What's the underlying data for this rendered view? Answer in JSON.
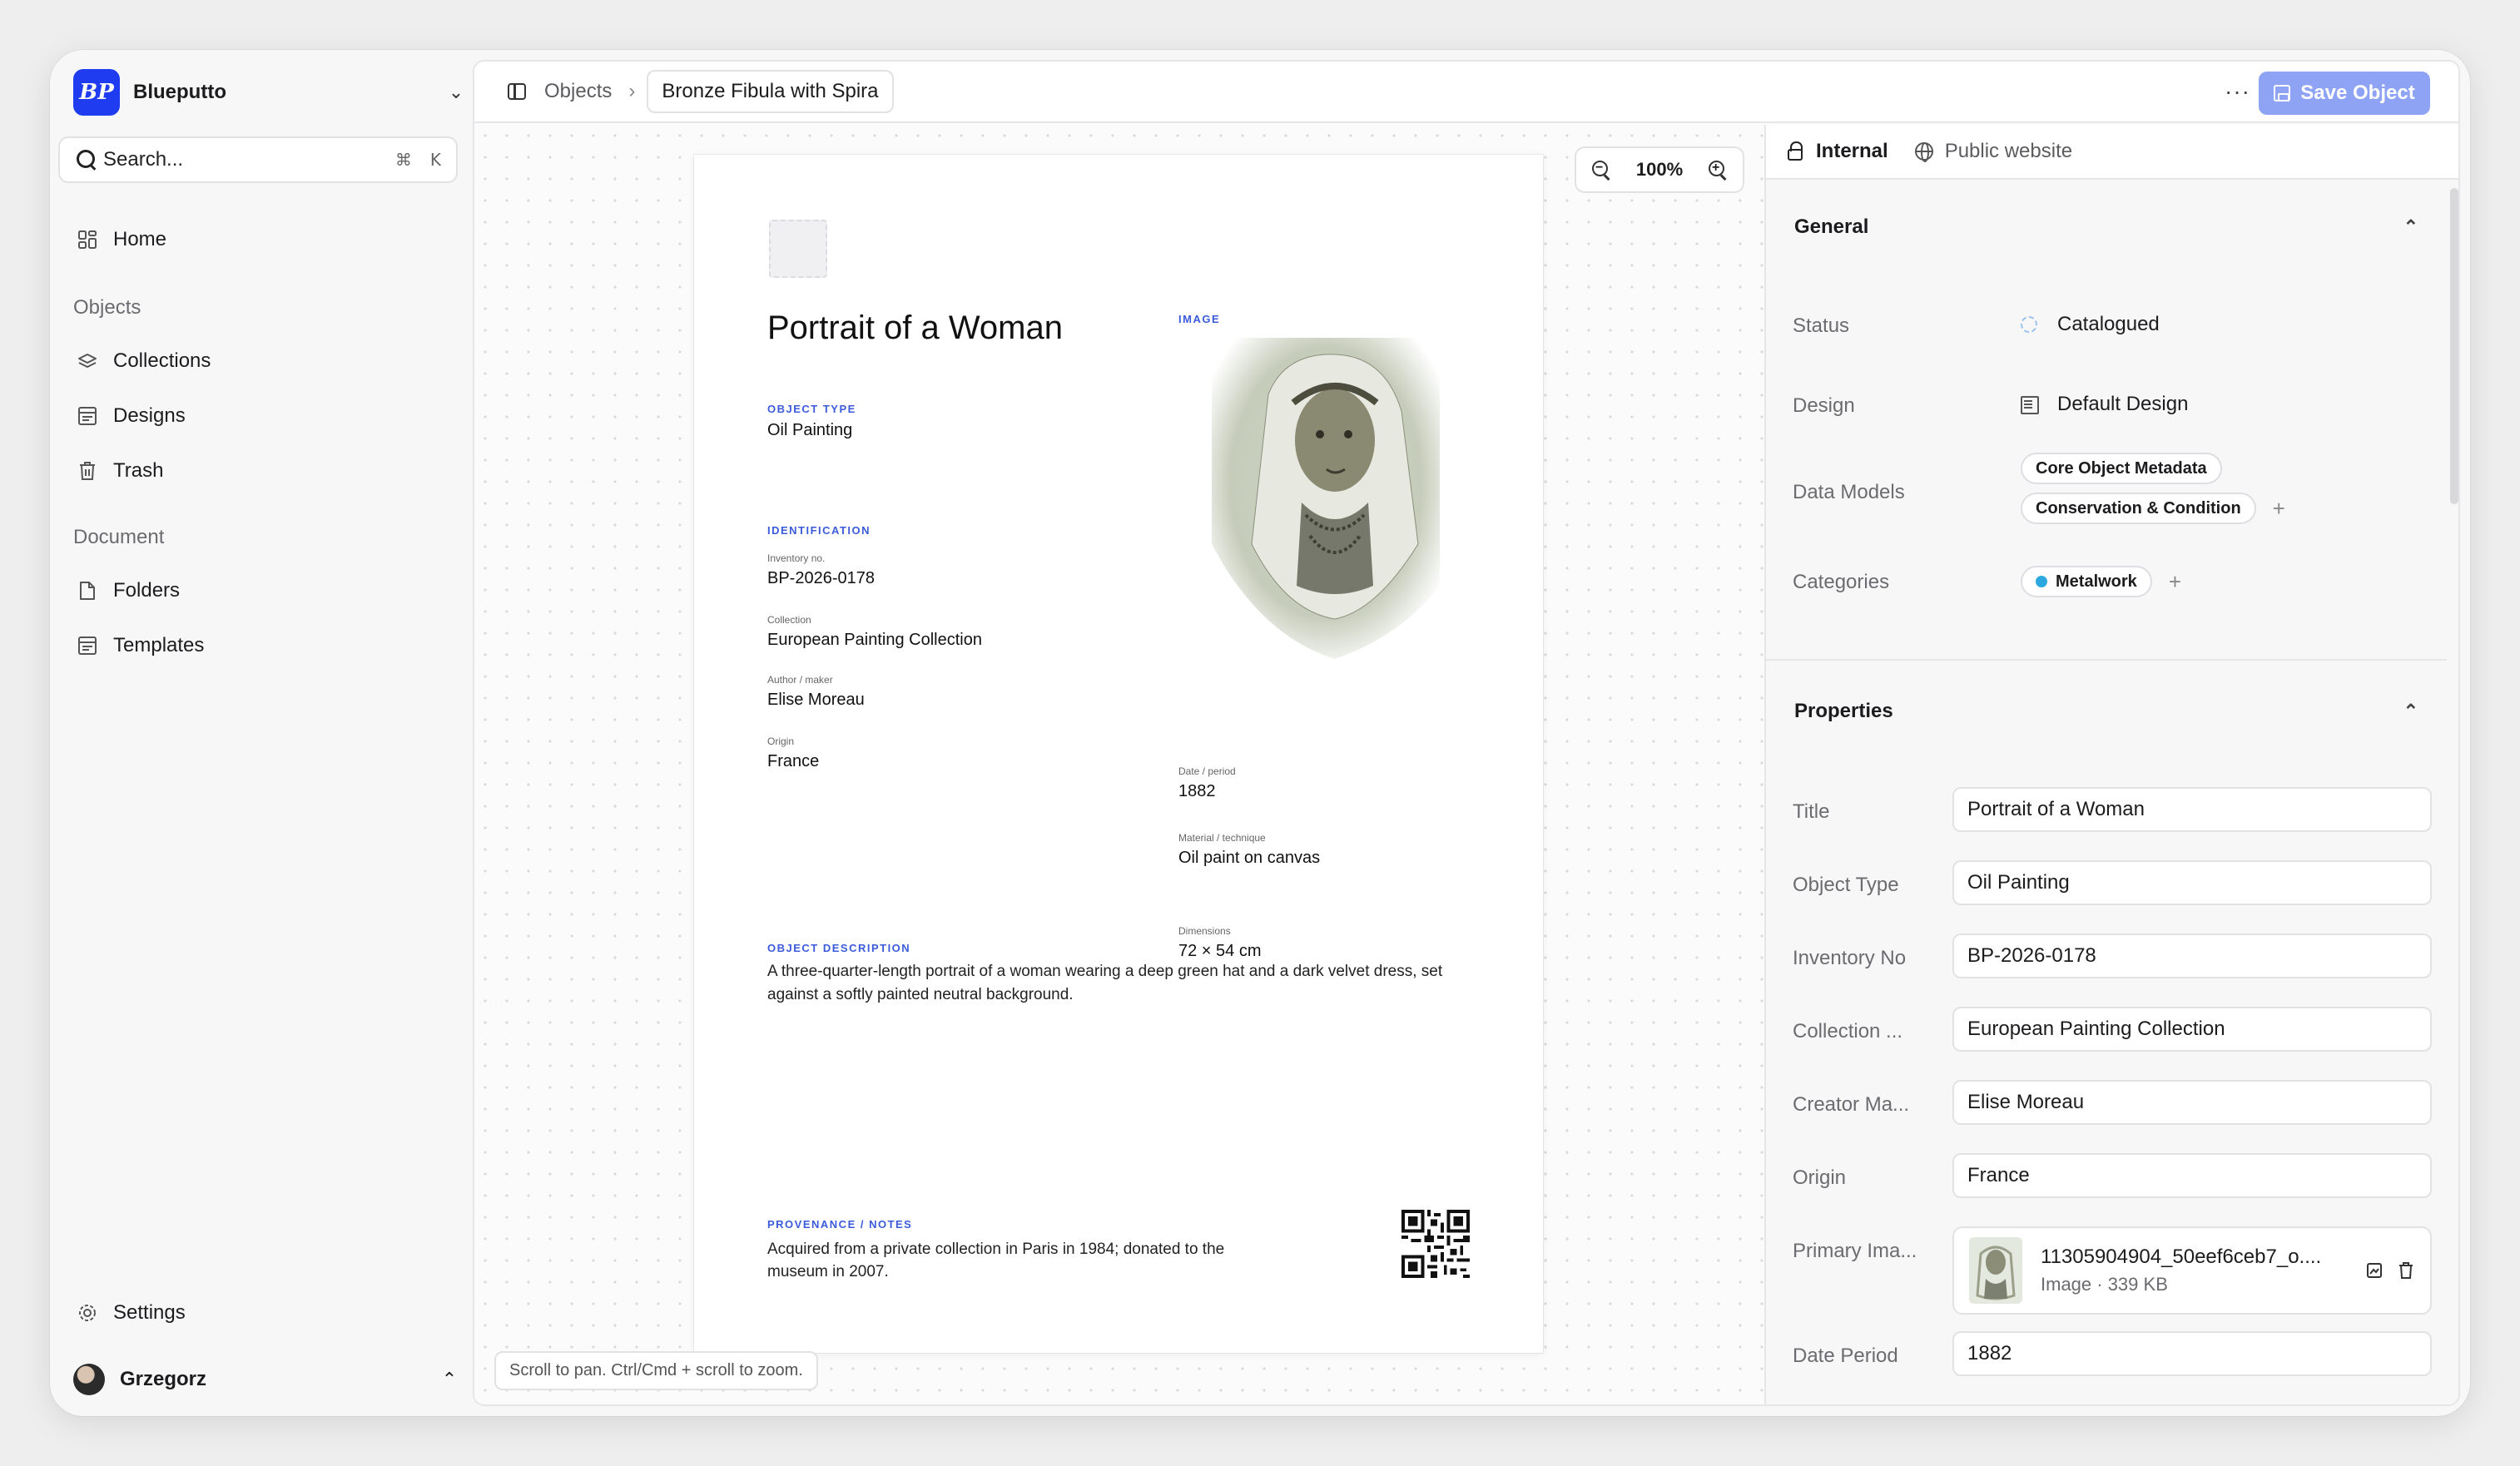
{
  "workspace": {
    "logo_text": "BP",
    "name": "Blueputto"
  },
  "search": {
    "label": "Search...",
    "shortcut_cmd": "⌘",
    "shortcut_key": "K"
  },
  "nav": {
    "home": "Home",
    "section_objects": "Objects",
    "collections": "Collections",
    "designs": "Designs",
    "trash": "Trash",
    "section_document": "Document",
    "folders": "Folders",
    "templates": "Templates",
    "settings": "Settings"
  },
  "user": {
    "name": "Grzegorz"
  },
  "topbar": {
    "breadcrumb_root": "Objects",
    "breadcrumb_current": "Bronze Fibula with Spira",
    "more": "···",
    "save_label": "Save Object"
  },
  "canvas": {
    "zoom": "100%",
    "hint": "Scroll to pan. Ctrl/Cmd + scroll to zoom."
  },
  "document": {
    "title": "Portrait of a Woman",
    "object_type_caption": "OBJECT TYPE",
    "object_type": "Oil Painting",
    "identification_caption": "IDENTIFICATION",
    "inventory_label": "Inventory no.",
    "inventory": "BP-2026-0178",
    "collection_label": "Collection",
    "collection": "European Painting Collection",
    "author_label": "Author / maker",
    "author": "Elise Moreau",
    "origin_label": "Origin",
    "origin": "France",
    "image_caption": "IMAGE",
    "date_label": "Date / period",
    "date": "1882",
    "material_label": "Material / technique",
    "material": "Oil paint on canvas",
    "dimensions_label": "Dimensions",
    "dimensions": "72 × 54 cm",
    "description_caption": "OBJECT DESCRIPTION",
    "description": "A three-quarter-length portrait of a woman wearing a deep green hat and a dark velvet dress, set against a softly painted neutral background.",
    "provenance_caption": "PROVENANCE / NOTES",
    "provenance": "Acquired from a private collection in Paris in 1984; donated to the museum in 2007."
  },
  "inspector": {
    "tab_internal": "Internal",
    "tab_public": "Public website",
    "general": {
      "heading": "General",
      "status_label": "Status",
      "status": "Catalogued",
      "design_label": "Design",
      "design": "Default Design",
      "data_models_label": "Data Models",
      "data_models": [
        "Core Object Metadata",
        "Conservation & Condition"
      ],
      "categories_label": "Categories",
      "category": "Metalwork",
      "category_color": "#2ba8e0"
    },
    "properties": {
      "heading": "Properties",
      "title_label": "Title",
      "title": "Portrait of a Woman",
      "object_type_label": "Object Type",
      "object_type": "Oil Painting",
      "inventory_label": "Inventory No",
      "inventory": "BP-2026-0178",
      "collection_label": "Collection ...",
      "collection": "European Painting Collection",
      "creator_label": "Creator Ma...",
      "creator": "Elise Moreau",
      "origin_label": "Origin",
      "origin": "France",
      "primary_image_label": "Primary Ima...",
      "primary_image_name": "11305904904_50eef6ceb7_o....",
      "primary_image_meta": "Image · 339 KB",
      "date_period_label": "Date Period",
      "date_period": "1882"
    }
  },
  "colors": {
    "accent": "#1f3cf0",
    "save_button": "#8fa3f5",
    "caption_blue": "#3b5bdb"
  }
}
